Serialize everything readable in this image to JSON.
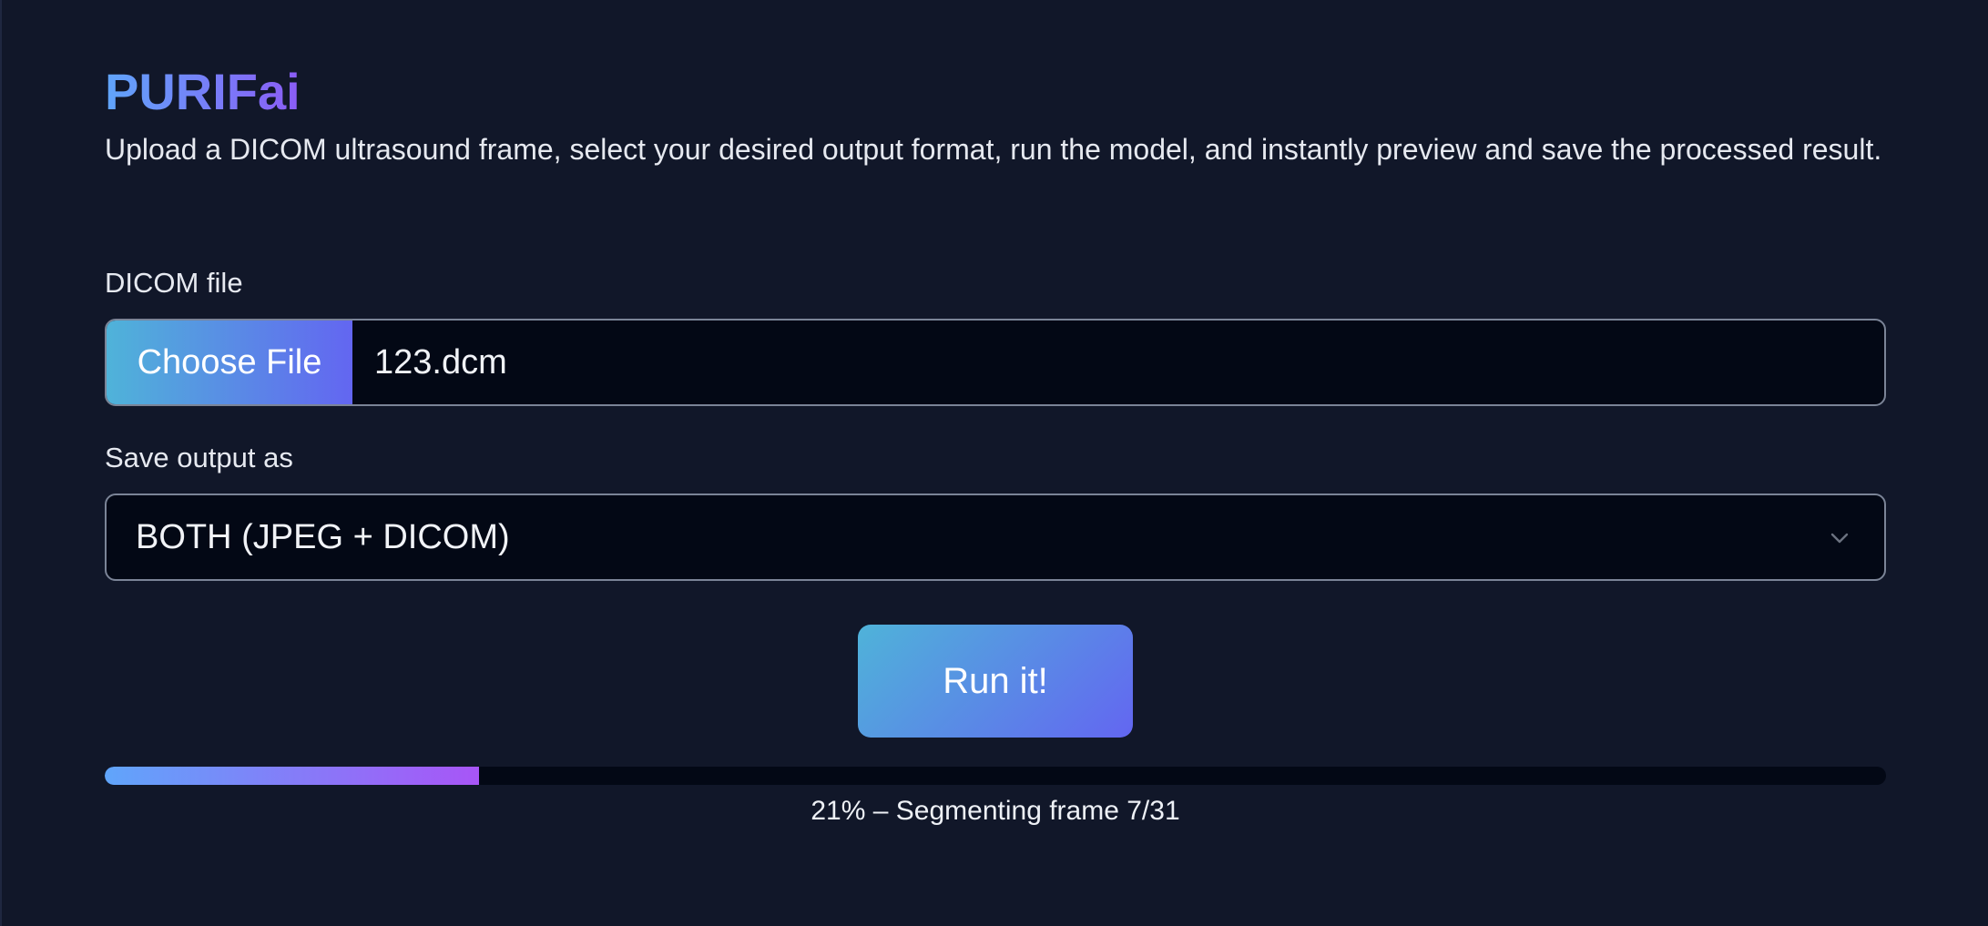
{
  "app": {
    "title": "PURIFai",
    "description": "Upload a DICOM ultrasound frame, select your desired output format, run the model, and instantly preview and save the processed result."
  },
  "file_field": {
    "label": "DICOM file",
    "button_label": "Choose File",
    "file_name": "123.dcm"
  },
  "output_field": {
    "label": "Save output as",
    "selected": "BOTH (JPEG + DICOM)",
    "icon": "chevron-down-icon"
  },
  "run_button": {
    "label": "Run it!"
  },
  "progress": {
    "percent": 21,
    "text": "21% – Segmenting frame 7/31"
  },
  "colors": {
    "background": "#111729",
    "input_background": "#030815",
    "accent_start": "#60a5fa",
    "accent_end": "#8b5cf6"
  }
}
